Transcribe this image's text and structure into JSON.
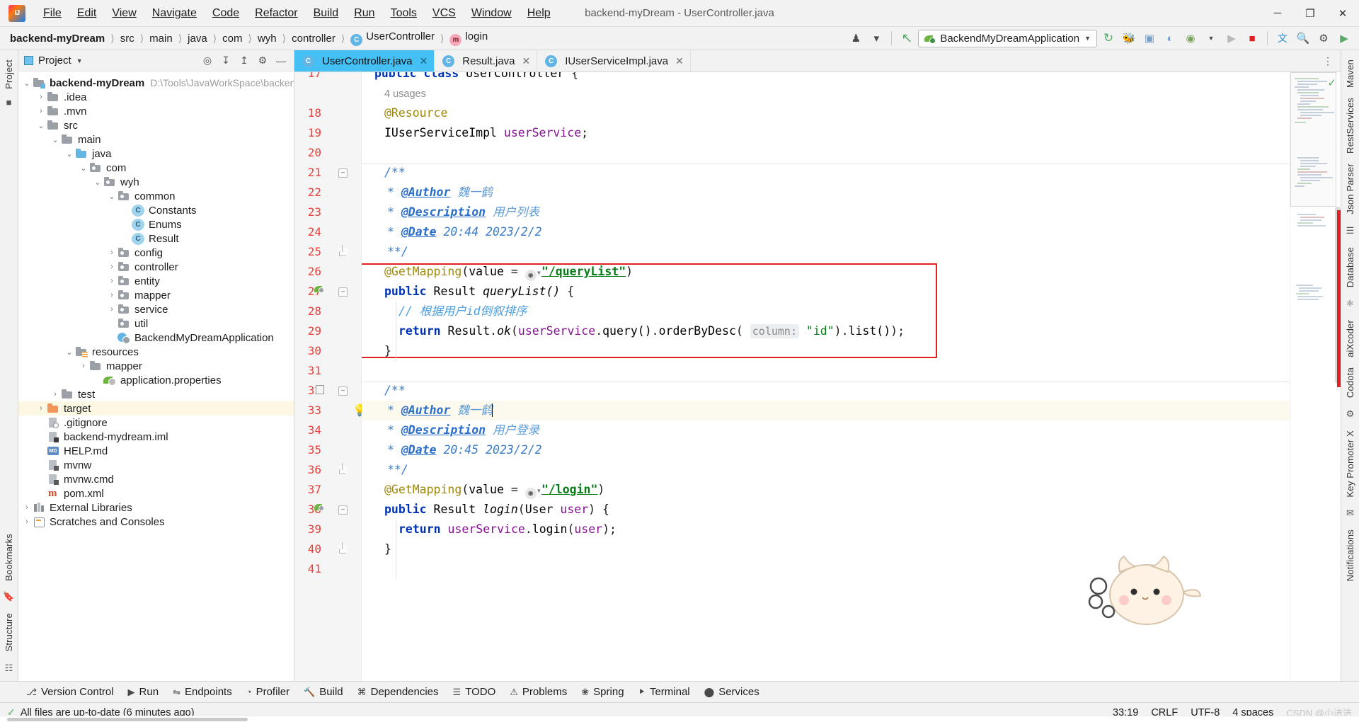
{
  "window": {
    "title": "backend-myDream - UserController.java",
    "minimize": "─",
    "maximize": "❐",
    "close": "✕"
  },
  "menubar": [
    {
      "label": "File"
    },
    {
      "label": "Edit"
    },
    {
      "label": "View"
    },
    {
      "label": "Navigate"
    },
    {
      "label": "Code"
    },
    {
      "label": "Refactor"
    },
    {
      "label": "Build"
    },
    {
      "label": "Run"
    },
    {
      "label": "Tools"
    },
    {
      "label": "VCS"
    },
    {
      "label": "Window"
    },
    {
      "label": "Help"
    }
  ],
  "breadcrumb": [
    {
      "label": "backend-myDream",
      "bold": true
    },
    {
      "label": "src"
    },
    {
      "label": "main"
    },
    {
      "label": "java"
    },
    {
      "label": "com"
    },
    {
      "label": "wyh"
    },
    {
      "label": "controller"
    },
    {
      "label": "UserController",
      "icon": "class-icon",
      "badge": "C"
    },
    {
      "label": "login",
      "icon": "method-icon",
      "badge": "m"
    }
  ],
  "toolbar": {
    "run_config": "BackendMyDreamApplication",
    "icons": [
      {
        "name": "user-settings-icon",
        "glyph": "⛭"
      },
      {
        "name": "update-project-icon",
        "glyph": "↖"
      },
      {
        "name": "rerun-icon",
        "glyph": "↻"
      },
      {
        "name": "debug-icon",
        "glyph": "🐞"
      },
      {
        "name": "run-with-coverage-icon",
        "glyph": "⬚"
      },
      {
        "name": "profiler-icon",
        "glyph": "◔"
      },
      {
        "name": "more-run-icon",
        "glyph": "▾"
      },
      {
        "name": "run-button-icon",
        "glyph": "▶"
      },
      {
        "name": "stop-button-icon",
        "glyph": "■"
      },
      {
        "name": "translate-icon",
        "glyph": "文"
      },
      {
        "name": "search-everywhere-icon",
        "glyph": "🔍"
      },
      {
        "name": "settings-icon",
        "glyph": "⚙"
      },
      {
        "name": "ide-sync-icon",
        "glyph": "▶"
      }
    ]
  },
  "left_rail": [
    {
      "label": "Project",
      "name": "rail-project"
    },
    {
      "label": "Bookmarks",
      "name": "rail-bookmarks"
    },
    {
      "label": "Structure",
      "name": "rail-structure"
    }
  ],
  "right_rail": [
    {
      "label": "Maven",
      "name": "rail-maven"
    },
    {
      "label": "RestServices",
      "name": "rail-restservices"
    },
    {
      "label": "Json Parser",
      "name": "rail-json-parser"
    },
    {
      "label": "Database",
      "name": "rail-database"
    },
    {
      "label": "aiXcoder",
      "name": "rail-aixcoder"
    },
    {
      "label": "Codota",
      "name": "rail-codota"
    },
    {
      "label": "Key Promoter X",
      "name": "rail-key-promoter-x"
    },
    {
      "label": "Notifications",
      "name": "rail-notifications"
    }
  ],
  "project_panel": {
    "title": "Project",
    "header_icons": [
      {
        "name": "select-opened-file-icon",
        "glyph": "⌖"
      },
      {
        "name": "expand-all-icon",
        "glyph": "⬍"
      },
      {
        "name": "collapse-all-icon",
        "glyph": "⬆"
      },
      {
        "name": "project-settings-icon",
        "glyph": "⚙"
      },
      {
        "name": "hide-panel-icon",
        "glyph": "─"
      }
    ],
    "tree": [
      {
        "label": "backend-myDream",
        "path": "D:\\Tools\\JavaWorkSpace\\backend-my",
        "indent": 0,
        "arrow": "⌄",
        "icon": "folder-module",
        "bold": true
      },
      {
        "label": ".idea",
        "indent": 1,
        "arrow": "›",
        "icon": "folder"
      },
      {
        "label": ".mvn",
        "indent": 1,
        "arrow": "›",
        "icon": "folder"
      },
      {
        "label": "src",
        "indent": 1,
        "arrow": "⌄",
        "icon": "folder"
      },
      {
        "label": "main",
        "indent": 2,
        "arrow": "⌄",
        "icon": "folder"
      },
      {
        "label": "java",
        "indent": 3,
        "arrow": "⌄",
        "icon": "folder-blue"
      },
      {
        "label": "com",
        "indent": 4,
        "arrow": "⌄",
        "icon": "folder-src"
      },
      {
        "label": "wyh",
        "indent": 5,
        "arrow": "⌄",
        "icon": "folder-src"
      },
      {
        "label": "common",
        "indent": 6,
        "arrow": "⌄",
        "icon": "folder-src"
      },
      {
        "label": "Constants",
        "indent": 7,
        "arrow": "",
        "icon": "class"
      },
      {
        "label": "Enums",
        "indent": 7,
        "arrow": "",
        "icon": "class"
      },
      {
        "label": "Result",
        "indent": 7,
        "arrow": "",
        "icon": "class"
      },
      {
        "label": "config",
        "indent": 6,
        "arrow": "›",
        "icon": "folder-src"
      },
      {
        "label": "controller",
        "indent": 6,
        "arrow": "›",
        "icon": "folder-src"
      },
      {
        "label": "entity",
        "indent": 6,
        "arrow": "›",
        "icon": "folder-src"
      },
      {
        "label": "mapper",
        "indent": 6,
        "arrow": "›",
        "icon": "folder-src"
      },
      {
        "label": "service",
        "indent": 6,
        "arrow": "›",
        "icon": "folder-src"
      },
      {
        "label": "util",
        "indent": 6,
        "arrow": "",
        "icon": "folder-src"
      },
      {
        "label": "BackendMyDreamApplication",
        "indent": 6,
        "arrow": "",
        "icon": "spring-class"
      },
      {
        "label": "resources",
        "indent": 3,
        "arrow": "⌄",
        "icon": "folder-resources"
      },
      {
        "label": "mapper",
        "indent": 4,
        "arrow": "›",
        "icon": "folder"
      },
      {
        "label": "application.properties",
        "indent": 5,
        "arrow": "",
        "icon": "spring-props"
      },
      {
        "label": "test",
        "indent": 2,
        "arrow": "›",
        "icon": "folder"
      },
      {
        "label": "target",
        "indent": 1,
        "arrow": "›",
        "icon": "folder-orange",
        "highlight": true
      },
      {
        "label": ".gitignore",
        "indent": 1,
        "arrow": "",
        "icon": "file-ignored"
      },
      {
        "label": "backend-mydream.iml",
        "indent": 1,
        "arrow": "",
        "icon": "file-iml"
      },
      {
        "label": "HELP.md",
        "indent": 1,
        "arrow": "",
        "icon": "file-md"
      },
      {
        "label": "mvnw",
        "indent": 1,
        "arrow": "",
        "icon": "file-sh"
      },
      {
        "label": "mvnw.cmd",
        "indent": 1,
        "arrow": "",
        "icon": "file-cmd"
      },
      {
        "label": "pom.xml",
        "indent": 1,
        "arrow": "",
        "icon": "file-maven"
      },
      {
        "label": "External Libraries",
        "indent": 0,
        "arrow": "›",
        "icon": "libraries"
      },
      {
        "label": "Scratches and Consoles",
        "indent": 0,
        "arrow": "›",
        "icon": "scratches"
      }
    ]
  },
  "tabs": [
    {
      "label": "UserController.java",
      "active": true,
      "badge": "C"
    },
    {
      "label": "Result.java",
      "active": false,
      "badge": "C"
    },
    {
      "label": "IUserServiceImpl.java",
      "active": false,
      "badge": "C"
    }
  ],
  "editor": {
    "first_line_number": 17,
    "usages_hint": "4 usages",
    "lines": [
      {
        "num": 17,
        "text": "public class UserController {"
      },
      {
        "num": null,
        "text": "4 usages"
      },
      {
        "num": 18,
        "text": "@Resource"
      },
      {
        "num": 19,
        "text": "IUserServiceImpl userService;"
      },
      {
        "num": 20,
        "text": ""
      },
      {
        "num": 21,
        "text": "/**"
      },
      {
        "num": 22,
        "text": " * @Author 魏一鹤"
      },
      {
        "num": 23,
        "text": " * @Description 用户列表"
      },
      {
        "num": 24,
        "text": " * @Date 20:44 2023/2/2"
      },
      {
        "num": 25,
        "text": " **/"
      },
      {
        "num": 26,
        "text": "@GetMapping(value = \"/queryList\")"
      },
      {
        "num": 27,
        "text": "public Result queryList() {"
      },
      {
        "num": 28,
        "text": "// 根据用户id倒叙排序"
      },
      {
        "num": 29,
        "text": "return Result.ok(userService.query().orderByDesc( column: \"id\").list());"
      },
      {
        "num": 30,
        "text": "}"
      },
      {
        "num": 31,
        "text": ""
      },
      {
        "num": 32,
        "text": "/**"
      },
      {
        "num": 33,
        "text": " * @Author 魏一鹤"
      },
      {
        "num": 34,
        "text": " * @Description 用户登录"
      },
      {
        "num": 35,
        "text": " * @Date 20:45 2023/2/2"
      },
      {
        "num": 36,
        "text": " **/"
      },
      {
        "num": 37,
        "text": "@GetMapping(value = \"/login\")"
      },
      {
        "num": 38,
        "text": "public Result login(User user) {"
      },
      {
        "num": 39,
        "text": "return userService.login(user);"
      },
      {
        "num": 40,
        "text": "}"
      },
      {
        "num": 41,
        "text": ""
      }
    ],
    "tokens": {
      "kw_public": "public",
      "kw_class": "class",
      "kw_return": "return",
      "type_UserController": "UserController",
      "brace_open": "{",
      "brace_close": "}",
      "ann_resource": "@Resource",
      "type_IUserServiceImpl": "IUserServiceImpl",
      "field_userService": "userService",
      "semi": ";",
      "jdoc_open": "/**",
      "jdoc_close": "**/",
      "jdoc_star": "*",
      "tag_author": "@Author",
      "tag_description": "@Description",
      "tag_date": "@Date",
      "author_name": "魏一鹤",
      "desc_querylist": "用户列表",
      "desc_login": "用户登录",
      "date_querylist": "20:44 2023/2/2",
      "date_login": "20:45 2023/2/2",
      "ann_getmapping": "@GetMapping",
      "value_eq": "(value = ",
      "path_querylist": "\"/queryList\"",
      "path_login": "\"/login\"",
      "close_paren": ")",
      "type_Result": "Result",
      "m_queryList": "queryList()",
      "m_login": "login",
      "comment_orderby": "// 根据用户id倒叙排序",
      "ret_querylist_a": "return ",
      "ret_querylist_b": "Result",
      "ret_dot": ".",
      "ret_ok": "ok",
      "ret_paren": "(",
      "hint_column": "column:",
      "str_id": "\"id\"",
      "m_query": "query()",
      "m_orderByDesc": "orderByDesc",
      "m_list": "list()",
      "type_User": "User",
      "param_user": "user"
    }
  },
  "bottom_tools": [
    {
      "label": "Version Control",
      "glyph": "⎇",
      "name": "tool-version-control"
    },
    {
      "label": "Run",
      "glyph": "▶",
      "name": "tool-run"
    },
    {
      "label": "Endpoints",
      "glyph": "⇋",
      "name": "tool-endpoints"
    },
    {
      "label": "Profiler",
      "glyph": "◔",
      "name": "tool-profiler"
    },
    {
      "label": "Build",
      "glyph": "🔨",
      "name": "tool-build"
    },
    {
      "label": "Dependencies",
      "glyph": "⌘",
      "name": "tool-dependencies"
    },
    {
      "label": "TODO",
      "glyph": "☰",
      "name": "tool-todo"
    },
    {
      "label": "Problems",
      "glyph": "⚠",
      "name": "tool-problems"
    },
    {
      "label": "Spring",
      "glyph": "❀",
      "name": "tool-spring"
    },
    {
      "label": "Terminal",
      "glyph": "⯈",
      "name": "tool-terminal"
    },
    {
      "label": "Services",
      "glyph": "⬤",
      "name": "tool-services"
    }
  ],
  "statusbar": {
    "message": "All files are up-to-date (6 minutes ago)",
    "caret_position": "33:19",
    "line_separator": "CRLF",
    "encoding": "UTF-8",
    "indent": "4 spaces",
    "watermark": "CSDN @小洁洁"
  },
  "colors": {
    "accent": "#45c0f5",
    "red_box": "#e02020",
    "keyword": "#0033b3",
    "string": "#067d17",
    "annotation": "#9e880d",
    "javadoc": "#3a7cc7",
    "field": "#871094",
    "line_number": "#e8413c",
    "highlight_row": "#fdf8e3"
  }
}
